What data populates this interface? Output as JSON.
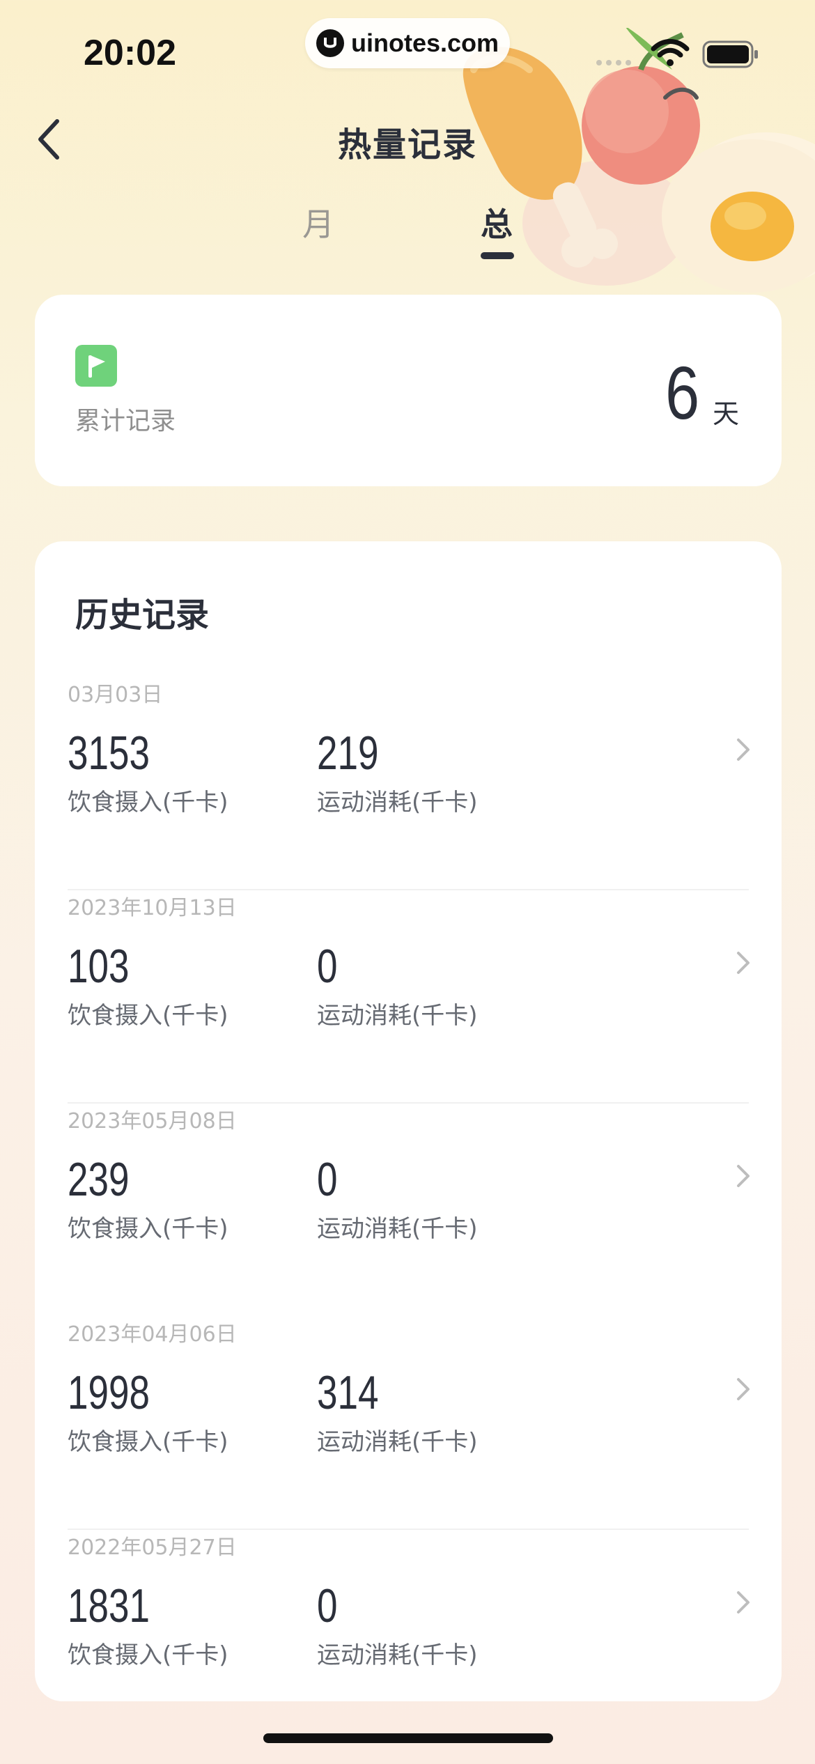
{
  "status_bar": {
    "time": "20:02",
    "watermark": "uinotes.com"
  },
  "nav": {
    "title": "热量记录",
    "tabs": [
      "月",
      "总"
    ],
    "active_tab": "总"
  },
  "summary": {
    "label": "累计记录",
    "value": "6",
    "unit": "天",
    "icon": "flag-icon"
  },
  "history": {
    "title": "历史记录",
    "intake_label": "饮食摄入(千卡)",
    "burn_label": "运动消耗(千卡)",
    "records": [
      {
        "date": "03月03日",
        "intake": "3153",
        "burn": "219"
      },
      {
        "date": "2023年10月13日",
        "intake": "103",
        "burn": "0"
      },
      {
        "date": "2023年05月08日",
        "intake": "239",
        "burn": "0"
      },
      {
        "date": "2023年04月06日",
        "intake": "1998",
        "burn": "314"
      },
      {
        "date": "2022年05月27日",
        "intake": "1831",
        "burn": "0"
      }
    ]
  },
  "colors": {
    "accent_green": "#6fd27b",
    "text_dark": "#2b2f3a",
    "card_bg": "#ffffff"
  }
}
